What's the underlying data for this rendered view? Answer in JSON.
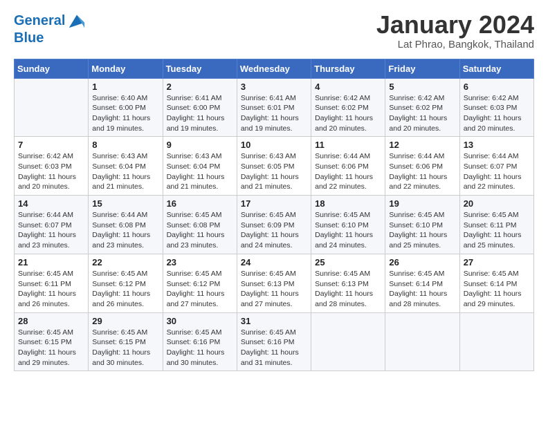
{
  "header": {
    "logo_line1": "General",
    "logo_line2": "Blue",
    "month": "January 2024",
    "location": "Lat Phrao, Bangkok, Thailand"
  },
  "weekdays": [
    "Sunday",
    "Monday",
    "Tuesday",
    "Wednesday",
    "Thursday",
    "Friday",
    "Saturday"
  ],
  "weeks": [
    [
      {
        "day": "",
        "sunrise": "",
        "sunset": "",
        "daylight": ""
      },
      {
        "day": "1",
        "sunrise": "6:40 AM",
        "sunset": "6:00 PM",
        "daylight": "11 hours and 19 minutes."
      },
      {
        "day": "2",
        "sunrise": "6:41 AM",
        "sunset": "6:00 PM",
        "daylight": "11 hours and 19 minutes."
      },
      {
        "day": "3",
        "sunrise": "6:41 AM",
        "sunset": "6:01 PM",
        "daylight": "11 hours and 19 minutes."
      },
      {
        "day": "4",
        "sunrise": "6:42 AM",
        "sunset": "6:02 PM",
        "daylight": "11 hours and 20 minutes."
      },
      {
        "day": "5",
        "sunrise": "6:42 AM",
        "sunset": "6:02 PM",
        "daylight": "11 hours and 20 minutes."
      },
      {
        "day": "6",
        "sunrise": "6:42 AM",
        "sunset": "6:03 PM",
        "daylight": "11 hours and 20 minutes."
      }
    ],
    [
      {
        "day": "7",
        "sunrise": "6:42 AM",
        "sunset": "6:03 PM",
        "daylight": "11 hours and 20 minutes."
      },
      {
        "day": "8",
        "sunrise": "6:43 AM",
        "sunset": "6:04 PM",
        "daylight": "11 hours and 21 minutes."
      },
      {
        "day": "9",
        "sunrise": "6:43 AM",
        "sunset": "6:04 PM",
        "daylight": "11 hours and 21 minutes."
      },
      {
        "day": "10",
        "sunrise": "6:43 AM",
        "sunset": "6:05 PM",
        "daylight": "11 hours and 21 minutes."
      },
      {
        "day": "11",
        "sunrise": "6:44 AM",
        "sunset": "6:06 PM",
        "daylight": "11 hours and 22 minutes."
      },
      {
        "day": "12",
        "sunrise": "6:44 AM",
        "sunset": "6:06 PM",
        "daylight": "11 hours and 22 minutes."
      },
      {
        "day": "13",
        "sunrise": "6:44 AM",
        "sunset": "6:07 PM",
        "daylight": "11 hours and 22 minutes."
      }
    ],
    [
      {
        "day": "14",
        "sunrise": "6:44 AM",
        "sunset": "6:07 PM",
        "daylight": "11 hours and 23 minutes."
      },
      {
        "day": "15",
        "sunrise": "6:44 AM",
        "sunset": "6:08 PM",
        "daylight": "11 hours and 23 minutes."
      },
      {
        "day": "16",
        "sunrise": "6:45 AM",
        "sunset": "6:08 PM",
        "daylight": "11 hours and 23 minutes."
      },
      {
        "day": "17",
        "sunrise": "6:45 AM",
        "sunset": "6:09 PM",
        "daylight": "11 hours and 24 minutes."
      },
      {
        "day": "18",
        "sunrise": "6:45 AM",
        "sunset": "6:10 PM",
        "daylight": "11 hours and 24 minutes."
      },
      {
        "day": "19",
        "sunrise": "6:45 AM",
        "sunset": "6:10 PM",
        "daylight": "11 hours and 25 minutes."
      },
      {
        "day": "20",
        "sunrise": "6:45 AM",
        "sunset": "6:11 PM",
        "daylight": "11 hours and 25 minutes."
      }
    ],
    [
      {
        "day": "21",
        "sunrise": "6:45 AM",
        "sunset": "6:11 PM",
        "daylight": "11 hours and 26 minutes."
      },
      {
        "day": "22",
        "sunrise": "6:45 AM",
        "sunset": "6:12 PM",
        "daylight": "11 hours and 26 minutes."
      },
      {
        "day": "23",
        "sunrise": "6:45 AM",
        "sunset": "6:12 PM",
        "daylight": "11 hours and 27 minutes."
      },
      {
        "day": "24",
        "sunrise": "6:45 AM",
        "sunset": "6:13 PM",
        "daylight": "11 hours and 27 minutes."
      },
      {
        "day": "25",
        "sunrise": "6:45 AM",
        "sunset": "6:13 PM",
        "daylight": "11 hours and 28 minutes."
      },
      {
        "day": "26",
        "sunrise": "6:45 AM",
        "sunset": "6:14 PM",
        "daylight": "11 hours and 28 minutes."
      },
      {
        "day": "27",
        "sunrise": "6:45 AM",
        "sunset": "6:14 PM",
        "daylight": "11 hours and 29 minutes."
      }
    ],
    [
      {
        "day": "28",
        "sunrise": "6:45 AM",
        "sunset": "6:15 PM",
        "daylight": "11 hours and 29 minutes."
      },
      {
        "day": "29",
        "sunrise": "6:45 AM",
        "sunset": "6:15 PM",
        "daylight": "11 hours and 30 minutes."
      },
      {
        "day": "30",
        "sunrise": "6:45 AM",
        "sunset": "6:16 PM",
        "daylight": "11 hours and 30 minutes."
      },
      {
        "day": "31",
        "sunrise": "6:45 AM",
        "sunset": "6:16 PM",
        "daylight": "11 hours and 31 minutes."
      },
      {
        "day": "",
        "sunrise": "",
        "sunset": "",
        "daylight": ""
      },
      {
        "day": "",
        "sunrise": "",
        "sunset": "",
        "daylight": ""
      },
      {
        "day": "",
        "sunrise": "",
        "sunset": "",
        "daylight": ""
      }
    ]
  ]
}
